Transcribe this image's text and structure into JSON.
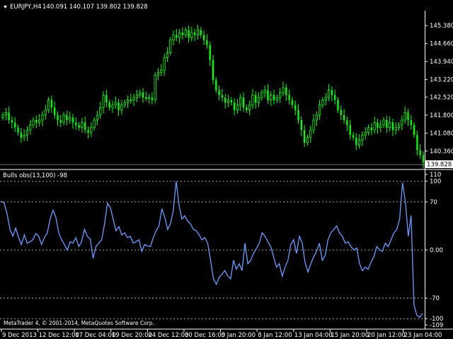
{
  "colors": {
    "background": "#000000",
    "bull_candle": "#00ff00",
    "indicator_line": "#6f9bff",
    "grid": "#ffffff",
    "text": "#ffffff",
    "price_marker_bg": "#ffffff",
    "price_marker_text": "#000000"
  },
  "header": {
    "arrow_icon": "triangle-down-icon",
    "symbol": "EURJPY,H4",
    "ohlc": "140.091 140.107 139.802 139.828"
  },
  "indicator_header": {
    "label": "Bulls obs(13,100) -98"
  },
  "copyright": "MetaTrader 4, © 2001-2014, MetaQuotes Software Corp.",
  "chart_data": [
    {
      "type": "candlestick",
      "title": "EURJPY,H4",
      "y_axis_labels": [
        "145.380",
        "144.660",
        "143.940",
        "143.220",
        "142.520",
        "141.800",
        "141.080",
        "140.360"
      ],
      "ylim": [
        139.82,
        145.95
      ],
      "last_price": "139.828",
      "close_series": [
        141.8,
        141.9,
        141.6,
        141.5,
        141.3,
        141.1,
        140.9,
        141.0,
        141.2,
        141.4,
        141.6,
        141.5,
        141.6,
        141.8,
        142.0,
        142.4,
        142.1,
        141.8,
        141.6,
        141.5,
        141.8,
        141.6,
        141.7,
        141.5,
        141.4,
        141.3,
        141.5,
        141.2,
        141.1,
        141.3,
        141.6,
        141.8,
        142.1,
        142.6,
        142.3,
        142.1,
        142.2,
        142.3,
        142.0,
        142.2,
        142.3,
        142.4,
        142.4,
        142.5,
        142.6,
        142.7,
        142.5,
        142.5,
        142.5,
        142.4,
        143.4,
        143.5,
        143.6,
        144.1,
        144.3,
        144.8,
        145.0,
        144.9,
        145.1,
        145.0,
        145.2,
        144.9,
        145.1,
        145.0,
        145.2,
        145.0,
        144.8,
        144.6,
        144.0,
        143.2,
        142.8,
        142.6,
        142.5,
        142.3,
        142.4,
        142.3,
        142.0,
        142.2,
        142.5,
        142.1,
        142.0,
        142.2,
        142.6,
        142.3,
        142.5,
        142.7,
        142.8,
        142.4,
        142.6,
        142.4,
        142.5,
        142.7,
        142.9,
        142.6,
        142.4,
        142.2,
        142.0,
        141.6,
        141.2,
        140.7,
        140.9,
        141.2,
        141.6,
        141.8,
        142.2,
        142.4,
        142.5,
        142.8,
        142.6,
        142.4,
        142.0,
        141.8,
        141.6,
        141.4,
        141.0,
        140.9,
        140.6,
        140.8,
        141.0,
        141.1,
        141.3,
        141.2,
        141.5,
        141.3,
        141.4,
        141.6,
        141.3,
        141.5,
        141.2,
        141.3,
        141.4,
        141.6,
        141.9,
        141.6,
        141.4,
        141.0,
        140.4,
        140.2,
        139.9
      ]
    },
    {
      "type": "line",
      "title": "Bulls obs(13,100) -98",
      "y_axis_labels": [
        "110",
        "100",
        "70",
        "0.00",
        "-70",
        "-100",
        "-109"
      ],
      "ylim": [
        -109,
        110
      ],
      "levels": [
        100,
        70,
        0,
        -70,
        -100
      ],
      "values": [
        71,
        68,
        52,
        30,
        20,
        32,
        18,
        8,
        22,
        10,
        12,
        15,
        24,
        20,
        8,
        18,
        25,
        45,
        58,
        48,
        25,
        15,
        8,
        0,
        12,
        10,
        18,
        5,
        12,
        30,
        20,
        16,
        -12,
        5,
        10,
        15,
        38,
        68,
        62,
        45,
        28,
        34,
        22,
        25,
        18,
        20,
        10,
        12,
        15,
        -2,
        8,
        6,
        5,
        18,
        28,
        35,
        60,
        48,
        30,
        38,
        58,
        100,
        65,
        45,
        50,
        42,
        38,
        30,
        28,
        22,
        15,
        18,
        10,
        -15,
        -42,
        -50,
        -40,
        -35,
        -30,
        -38,
        -42,
        -15,
        -28,
        -20,
        -30,
        10,
        -20,
        -15,
        -5,
        2,
        10,
        25,
        20,
        12,
        5,
        -10,
        -25,
        -20,
        -38,
        -25,
        -15,
        8,
        15,
        -5,
        20,
        10,
        -18,
        -32,
        -20,
        -10,
        -2,
        10,
        -15,
        -8,
        15,
        25,
        30,
        35,
        25,
        20,
        10,
        12,
        5,
        0,
        3,
        -20,
        -30,
        -25,
        -28,
        -18,
        -10,
        5,
        0,
        -2,
        10,
        5,
        15,
        25,
        30,
        45,
        98,
        70,
        20,
        50,
        -80,
        -95,
        -98,
        -92
      ]
    }
  ],
  "x_axis_labels": [
    "9 Dec 2013",
    "12 Dec 12:00",
    "17 Dec 04:00",
    "19 Dec 20:00",
    "24 Dec 12:00",
    "30 Dec 16:00",
    "3 Jan 20:00",
    "8 Jan 12:00",
    "13 Jan 04:00",
    "15 Jan 20:00",
    "20 Jan 12:00",
    "23 Jan 04:00"
  ]
}
